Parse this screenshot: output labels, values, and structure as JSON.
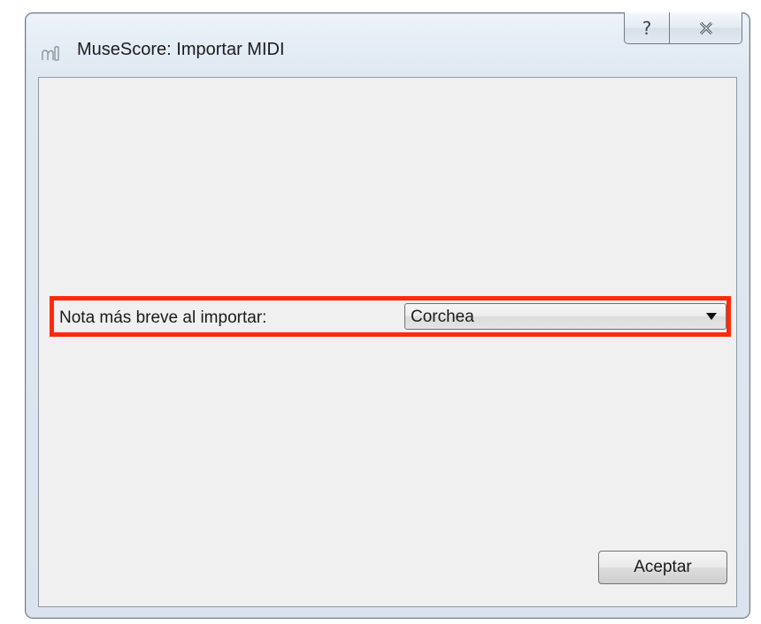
{
  "window": {
    "title": "MuseScore: Importar MIDI",
    "app_icon": "musescore-logo-icon",
    "help_icon": "help-question-icon",
    "close_icon": "close-x-icon"
  },
  "form": {
    "shortest_note_label": "Nota más breve al importar:",
    "shortest_note_value": "Corchea",
    "dropdown_icon": "dropdown-arrow-icon"
  },
  "buttons": {
    "accept_label": "Aceptar"
  },
  "colors": {
    "highlight": "#ff2a0c",
    "dialog_background": "#f0f0f0",
    "window_frame": "#dfe7f1"
  }
}
